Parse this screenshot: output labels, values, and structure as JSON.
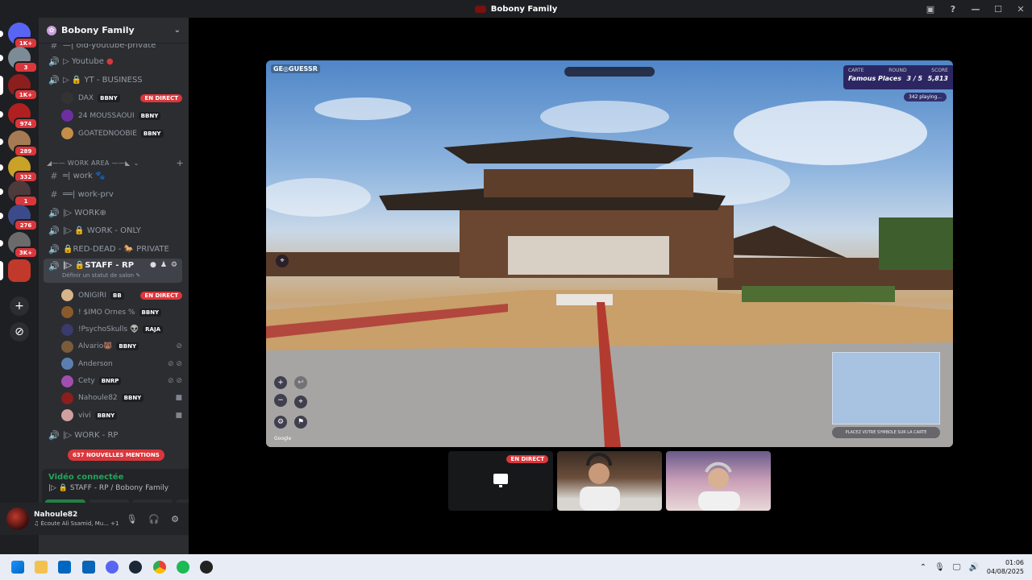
{
  "window": {
    "title": "Bobony Family"
  },
  "guilds": [
    {
      "badge": "1K+",
      "color": "#5865f2"
    },
    {
      "badge": "3",
      "color": "#7d8b96"
    },
    {
      "badge": "1K+",
      "color": "#8c1e1e"
    },
    {
      "badge": "974",
      "color": "#b02020"
    },
    {
      "badge": "289",
      "color": "#a67a52"
    },
    {
      "badge": "332",
      "color": "#c9a227"
    },
    {
      "badge": "1",
      "color": "#4d3b3b"
    },
    {
      "badge": "276",
      "color": "#3b4b8a"
    },
    {
      "badge": "3K+",
      "color": "#6b6b6b"
    },
    {
      "badge": "",
      "color": "#c0392b"
    }
  ],
  "server": {
    "name": "Bobony Family"
  },
  "channels": {
    "old_youtube": "—| old-youtube-private",
    "youtube": "▷ Youtube",
    "yt_business": "▷ 🔒 YT - BUSINESS",
    "cat_work_area": "◢—— WORK AREA ——◣",
    "work": "═| work 🐾",
    "work_prv": "══| work-prv",
    "work_o": "|▷ WORK⊕",
    "work_only": "|▷ 🔒 WORK - ONLY",
    "red_dead": "🔒RED-DEAD - 🐎 PRIVATE",
    "staff_rp": "|▷ 🔒STAFF - RP",
    "staff_sub": "Définir un statut de salon ✎",
    "work_rp": "|▷ WORK - RP"
  },
  "voice_users_top": [
    {
      "name": "DAX",
      "tag": "BBNY",
      "live": "EN DIRECT",
      "color": "#333"
    },
    {
      "name": "24 MOUSSAOUI",
      "tag": "BBNY",
      "live": "",
      "color": "#6b2fa0"
    },
    {
      "name": "GOATEDNOOBIE",
      "tag": "BBNY",
      "live": "",
      "color": "#c58e4a"
    }
  ],
  "voice_users": [
    {
      "name": "ONIGIRI",
      "tag": "BB",
      "live": "EN DIRECT",
      "color": "#d8b48a",
      "icons": ""
    },
    {
      "name": "! $IMO Ornes %",
      "tag": "BBNY",
      "live": "",
      "color": "#8a5a2b",
      "icons": ""
    },
    {
      "name": "!PsychoSkulls 👽",
      "tag": "RAJA",
      "live": "",
      "color": "#3a3a6b",
      "icons": ""
    },
    {
      "name": "Alvario🐻",
      "tag": "BBNY",
      "live": "",
      "color": "#7a5c3a",
      "icons": "⊘"
    },
    {
      "name": "Anderson",
      "tag": "",
      "live": "",
      "color": "#5b7fb0",
      "icons": "⊘ ⊘"
    },
    {
      "name": "Cety",
      "tag": "BNRP",
      "live": "",
      "color": "#a04fb0",
      "icons": "⊘ ⊘"
    },
    {
      "name": "Nahoule82",
      "tag": "BBNY",
      "live": "",
      "color": "#8c1e1e",
      "icons": "■"
    },
    {
      "name": "vivi",
      "tag": "BBNY",
      "live": "",
      "color": "#d0a0a0",
      "icons": "■"
    }
  ],
  "mentions": "637 NOUVELLES MENTIONS",
  "voice_panel": {
    "status": "Vidéo connectée",
    "channel": "|▷ 🔒 STAFF - RP / Bobony Family"
  },
  "user_panel": {
    "name": "Nahoule82",
    "status": "♫ Écoute Ali Ssamid, Mu...",
    "extra": "+1"
  },
  "stream": {
    "logo": "GE◎GUESSR",
    "score": {
      "map_label": "CARTE",
      "round_label": "ROUND",
      "score_label": "SCORE",
      "map": "Famous Places",
      "round": "3 / 5",
      "score": "5,813"
    },
    "players": "342 playing...",
    "place_label": "PLACEZ VOTRE SYMBOLE SUR LA CARTE",
    "google": "Google"
  },
  "tiles": {
    "live": "EN DIRECT"
  },
  "taskbar": {
    "time": "01:06",
    "date": "04/08/2025"
  }
}
